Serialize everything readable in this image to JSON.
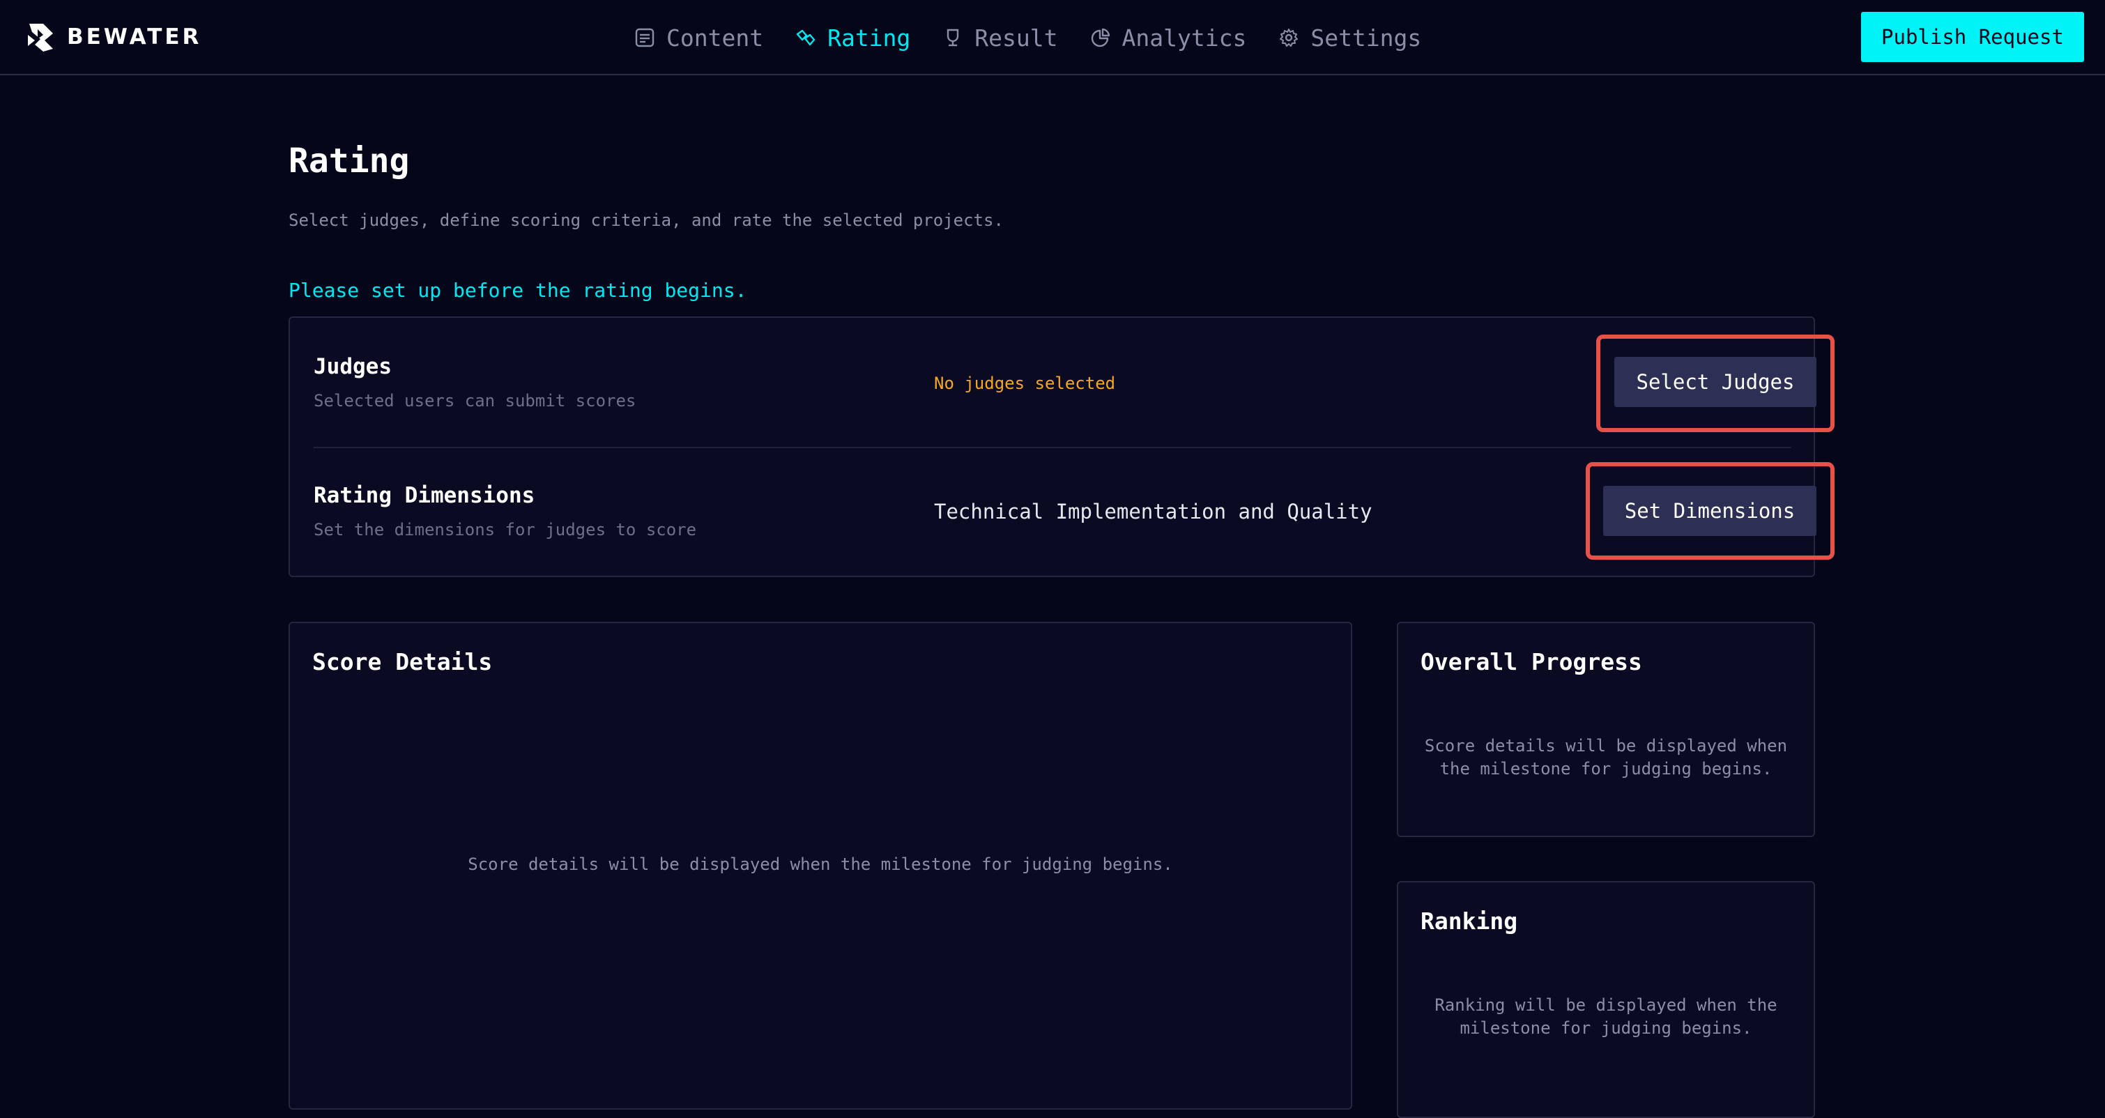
{
  "app": {
    "brand": "BEWATER"
  },
  "nav": {
    "items": [
      {
        "label": "Content",
        "icon": "document-icon"
      },
      {
        "label": "Rating",
        "icon": "rating-icon",
        "active": true
      },
      {
        "label": "Result",
        "icon": "trophy-icon"
      },
      {
        "label": "Analytics",
        "icon": "pie-chart-icon"
      },
      {
        "label": "Settings",
        "icon": "gear-icon"
      }
    ],
    "publish_label": "Publish Request"
  },
  "page": {
    "title": "Rating",
    "subtitle": "Select judges, define scoring criteria, and rate the selected projects.",
    "setup_notice": "Please set up before the rating begins."
  },
  "setup": {
    "judges": {
      "title": "Judges",
      "description": "Selected users can submit scores",
      "status": "No judges selected",
      "button": "Select Judges"
    },
    "dimensions": {
      "title": "Rating Dimensions",
      "description": "Set the dimensions for judges to score",
      "value": "Technical Implementation and Quality",
      "button": "Set Dimensions"
    }
  },
  "panels": {
    "score_details": {
      "title": "Score Details",
      "message": "Score details will be displayed when the milestone for judging begins."
    },
    "overall_progress": {
      "title": "Overall Progress",
      "message": "Score details will be displayed when the milestone for judging begins."
    },
    "ranking": {
      "title": "Ranking",
      "message": "Ranking will be displayed when the milestone for judging begins."
    }
  },
  "colors": {
    "background": "#05061a",
    "accent": "#00f3f7",
    "warning": "#f5a623",
    "highlight": "#e8504a",
    "button": "#2d2f54"
  }
}
